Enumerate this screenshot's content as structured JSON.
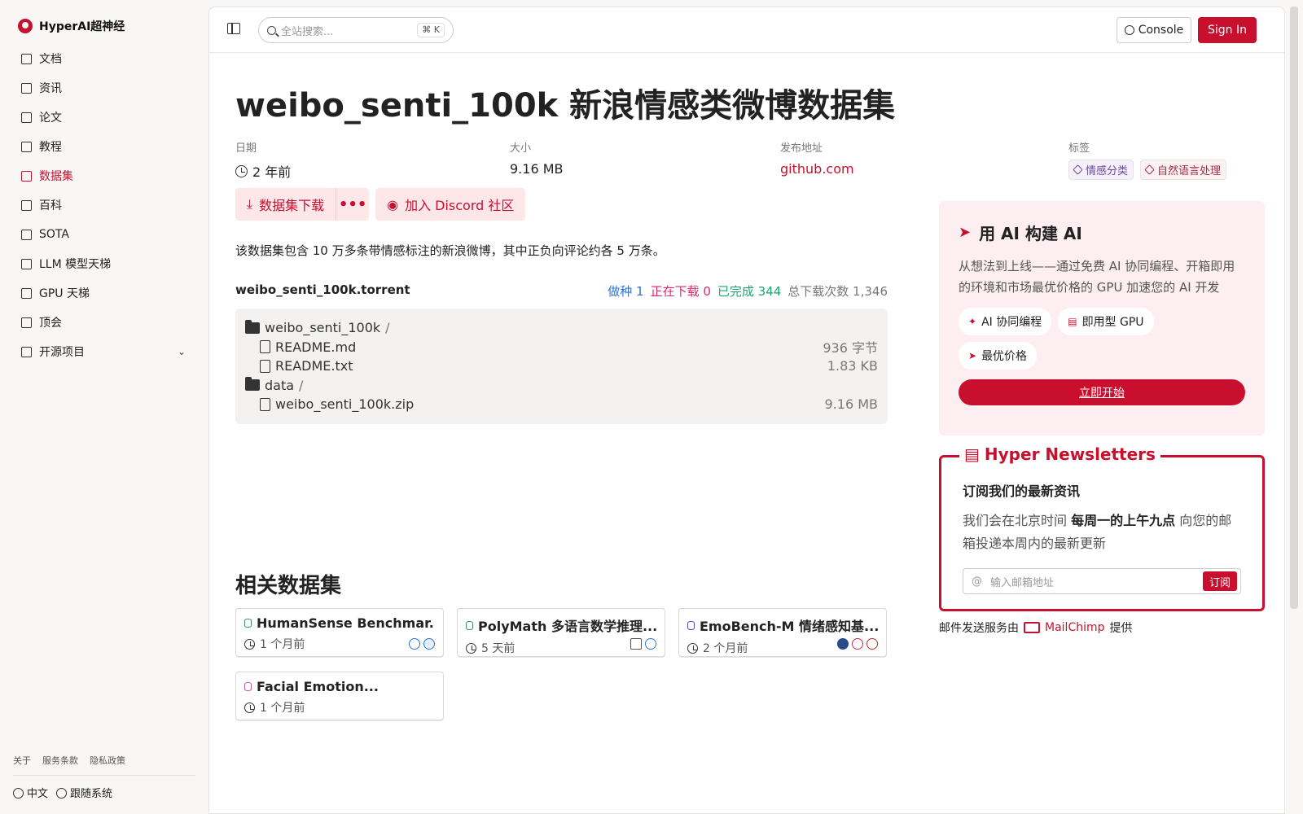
{
  "brand": {
    "name": "HyperAI超神经"
  },
  "sidebar": {
    "items": [
      {
        "label": "文档",
        "icon": "doc-icon"
      },
      {
        "label": "资讯",
        "icon": "news-icon"
      },
      {
        "label": "论文",
        "icon": "paper-icon"
      },
      {
        "label": "教程",
        "icon": "book-icon"
      },
      {
        "label": "数据集",
        "icon": "database-icon",
        "active": true
      },
      {
        "label": "百科",
        "icon": "wiki-icon"
      },
      {
        "label": "SOTA",
        "icon": "chart-icon"
      },
      {
        "label": "LLM 模型天梯",
        "icon": "chip-icon"
      },
      {
        "label": "GPU 天梯",
        "icon": "monitor-icon"
      },
      {
        "label": "顶会",
        "icon": "calendar-icon"
      },
      {
        "label": "开源项目",
        "icon": "list-icon"
      }
    ],
    "footer_links": [
      "关于",
      "服务条款",
      "隐私政策"
    ],
    "language": "中文",
    "theme": "跟随系统"
  },
  "topbar": {
    "search_placeholder": "全站搜索...",
    "shortcut": "K",
    "console_label": "Console",
    "signin_label": "Sign In"
  },
  "dataset": {
    "title": "weibo_senti_100k 新浪情感类微博数据集",
    "date_label": "日期",
    "date_value": "2 年前",
    "size_label": "大小",
    "size_value": "9.16 MB",
    "source_label": "发布地址",
    "source_value": "github.com",
    "tags_label": "标签",
    "tags": [
      "情感分类",
      "自然语言处理"
    ],
    "download_label": "数据集下载",
    "more_label": "•••",
    "discord_label": "加入 Discord 社区",
    "description": "该数据集包含 10 万多条带情感标注的新浪微博，其中正负向评论约各 5 万条。",
    "torrent_name": "weibo_senti_100k.torrent",
    "stats": {
      "seeding": "做种 1",
      "downloading": "正在下载 0",
      "completed": "已完成 344",
      "total": "总下载次数 1,346"
    },
    "files": [
      {
        "name": "weibo_senti_100k",
        "suffix": "/",
        "type": "folder",
        "size": ""
      },
      {
        "name": "README.md",
        "suffix": "",
        "type": "file",
        "size": "936 字节"
      },
      {
        "name": "README.txt",
        "suffix": "",
        "type": "file",
        "size": "1.83 KB"
      },
      {
        "name": "data",
        "suffix": "/",
        "type": "folder",
        "size": ""
      },
      {
        "name": "weibo_senti_100k.zip",
        "suffix": "",
        "type": "file",
        "size": "9.16 MB"
      }
    ]
  },
  "ai_card": {
    "title": "用 AI 构建 AI",
    "description": "从想法到上线——通过免费 AI 协同编程、开箱即用的环境和市场最优价格的 GPU 加速您的 AI 开发",
    "pills": [
      "AI 协同编程",
      "即用型 GPU",
      "最优价格"
    ],
    "cta": "立即开始"
  },
  "newsletter": {
    "legend": "Hyper Newsletters",
    "heading": "订阅我们的最新资讯",
    "text_before": "我们会在北京时间 ",
    "text_bold": "每周一的上午九点",
    "text_after": " 向您的邮箱投递本周内的最新更新",
    "email_placeholder": "输入邮箱地址",
    "subscribe": "订阅",
    "note_before": "邮件发送服务由",
    "note_brand": "MailChimp",
    "note_after": "提供"
  },
  "related": {
    "heading": "相关数据集",
    "cards": [
      {
        "title": "HumanSense Benchmar...",
        "date": "1 个月前",
        "color": "#3a9d5d"
      },
      {
        "title": "PolyMath 多语言数学推理...",
        "date": "5 天前",
        "color": "#3a9d5d"
      },
      {
        "title": "EmoBench-M 情绪感知基...",
        "date": "2 个月前",
        "color": "#4b56c8"
      },
      {
        "title": "Facial Emotion...",
        "date": "1 个月前",
        "color": "#c85ca8"
      }
    ]
  }
}
